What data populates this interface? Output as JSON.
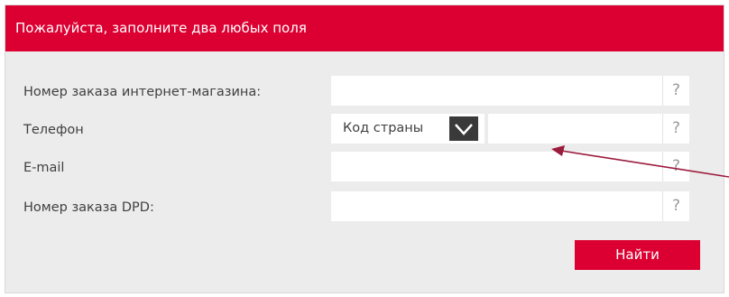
{
  "header": {
    "title": "Пожалуйста, заполните два любых поля"
  },
  "form": {
    "fields": [
      {
        "label": "Номер заказа интернет-магазина:",
        "value": "",
        "help": "?"
      },
      {
        "label": "Телефон",
        "country_placeholder": "Код страны",
        "value": "",
        "help": "?"
      },
      {
        "label": "E-mail",
        "value": "",
        "help": "?"
      },
      {
        "label": "Номер заказа DPD:",
        "value": "",
        "help": "?"
      }
    ],
    "submit_label": "Найти"
  },
  "colors": {
    "brand": "#dc0032",
    "panel": "#ececec",
    "dropdown_button": "#3a3a3a",
    "annotation_arrow": "#9b1b3c"
  },
  "icons": {
    "dropdown": "chevron-down-icon",
    "annotation": "annotation-arrow"
  }
}
